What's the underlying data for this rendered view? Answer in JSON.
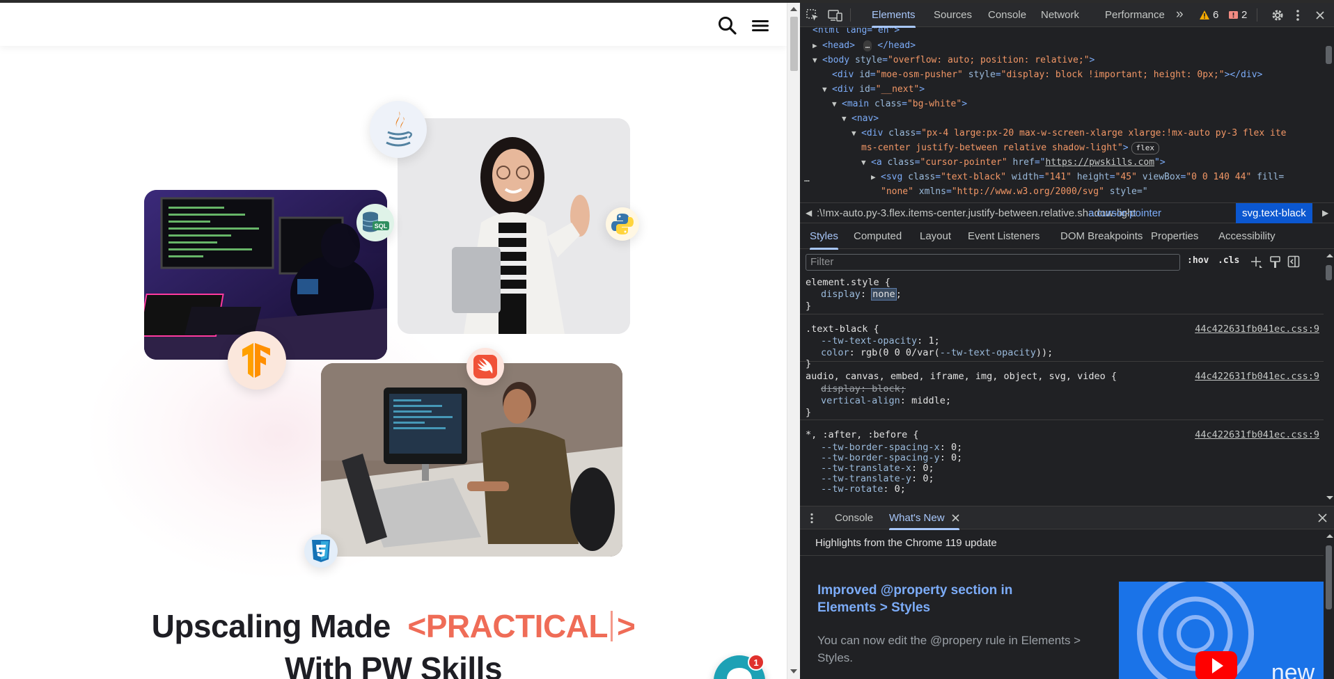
{
  "page": {
    "headline_prefix": "Upscaling Made",
    "headline_highlight_open": "<PRACTICAL",
    "headline_highlight_close": ">",
    "headline_line2": "With PW Skills",
    "chat_badge_count": "1",
    "icons": {
      "search": "search-icon",
      "menu": "hamburger-menu-icon",
      "java": "java-logo-icon",
      "sql": "sql-database-icon",
      "python": "python-logo-icon",
      "tensorflow": "tensorflow-logo-icon",
      "swift": "swift-logo-icon",
      "css3": "css3-logo-icon",
      "chat": "chat-bubble-icon"
    },
    "sql_label": "SQL",
    "colors": {
      "accent": "#ef6c57",
      "chat": "#1da1b5"
    }
  },
  "devtools": {
    "tabs": [
      "Elements",
      "Sources",
      "Console",
      "Network",
      "Performance"
    ],
    "active_tab": "Elements",
    "more_tabs": "»",
    "warnings_count": "6",
    "errors_count": "2",
    "dom": {
      "line1_tag": "<html lang=\"en\">",
      "head_open": "<head>",
      "head_close": "</head>",
      "body_tag": "<body",
      "body_attr": "style",
      "body_val": "\"overflow: auto; position: relative;\"",
      "pusher_tag_open": "<div",
      "pusher_attr_id": "id",
      "pusher_val_id": "\"moe-osm-pusher\"",
      "pusher_attr_style": "style",
      "pusher_val_style": "\"display: block !important; height: 0px;\"",
      "pusher_close": "></div>",
      "next_open": "<div",
      "next_attr": "id",
      "next_val": "\"__next\"",
      "main_open": "<main",
      "main_attr": "class",
      "main_val": "\"bg-white\"",
      "nav": "<nav>",
      "div_open": "<div",
      "div_attr": "class",
      "div_val_1": "\"px-4 large:px-20 max-w-screen-xlarge xlarge:!mx-auto py-3 flex ite",
      "div_val_2": "ms-center justify-between relative shadow-light\"",
      "flex_badge": "flex",
      "a_open": "<a",
      "a_attr_class": "class",
      "a_val_class": "\"cursor-pointer\"",
      "a_attr_href": "href",
      "a_val_href": "https://pwskills.com",
      "svg_open": "<svg",
      "svg_attr_class": "class",
      "svg_val_class": "\"text-black\"",
      "svg_attr_w": "width",
      "svg_val_w": "\"141\"",
      "svg_attr_h": "height",
      "svg_val_h": "\"45\"",
      "svg_attr_vb": "viewBox",
      "svg_val_vb": "\"0 0 140 44\"",
      "svg_attr_fill": "fill=",
      "svg_val_fill": "\"none\"",
      "svg_attr_xmlns": "xmlns",
      "svg_val_xmlns": "\"http://www.w3.org/2000/svg\"",
      "svg_attr_style": "style=\"",
      "ellipsis": "…"
    },
    "breadcrumbs": [
      ":\\!mx-auto.py-3.flex.items-center.justify-between.relative.shadow-light",
      "a.cursor-pointer",
      "svg.text-black"
    ],
    "subtabs": [
      "Styles",
      "Computed",
      "Layout",
      "Event Listeners",
      "DOM Breakpoints",
      "Properties",
      "Accessibility"
    ],
    "active_subtab": "Styles",
    "filter_placeholder": "Filter",
    "hov": ":hov",
    "cls": ".cls",
    "styles": {
      "r1_selector": "element.style {",
      "r1_prop": "display",
      "r1_val": "none",
      "close": "}",
      "r2_selector": ".text-black {",
      "r2_src": "44c422631fb041ec.css:9",
      "r2_p1": "--tw-text-opacity",
      "r2_v1": "1;",
      "r2_p2": "color",
      "r2_v2a": "rgb(0 0 0/var(",
      "r2_v2b": "--tw-text-opacity",
      "r2_v2c": "));",
      "r3_selector": "audio, canvas, embed, iframe, img, object, svg, video {",
      "r3_src": "44c422631fb041ec.css:9",
      "r3_p1": "display: block;",
      "r3_p2": "vertical-align",
      "r3_v2": "middle;",
      "r4_selector": "*, :after, :before {",
      "r4_src": "44c422631fb041ec.css:9",
      "r4_p1": "--tw-border-spacing-x",
      "r4_p2": "--tw-border-spacing-y",
      "r4_p3": "--tw-translate-x",
      "r4_p4": "--tw-translate-y",
      "r4_p5": "--tw-rotate",
      "zero": "0;"
    },
    "drawer": {
      "tabs": [
        "Console",
        "What's New"
      ],
      "active": "What's New",
      "highlights": "Highlights from the Chrome 119 update",
      "feature_title": "Improved @property section in Elements > Styles",
      "feature_text": "You can now edit the @propery rule in Elements > Styles.",
      "video_label": "new"
    }
  }
}
